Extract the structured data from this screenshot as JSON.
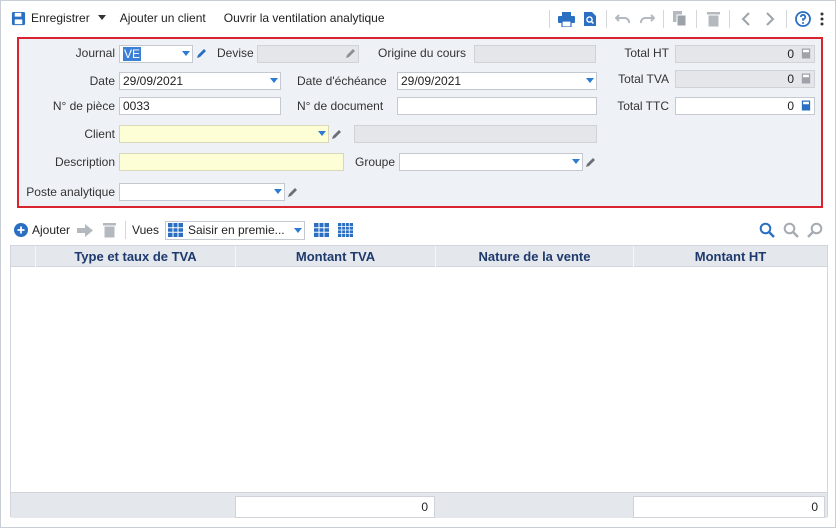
{
  "toolbar": {
    "save_label": "Enregistrer",
    "add_client_label": "Ajouter un client",
    "open_ventilation_label": "Ouvrir la ventilation analytique"
  },
  "form": {
    "journal": {
      "label": "Journal",
      "value": "VE"
    },
    "devise": {
      "label": "Devise",
      "value": ""
    },
    "origine_cours": {
      "label": "Origine du cours",
      "value": ""
    },
    "total_ht": {
      "label": "Total HT",
      "value": "0"
    },
    "date": {
      "label": "Date",
      "value": "29/09/2021"
    },
    "date_echeance": {
      "label": "Date d'échéance",
      "value": "29/09/2021"
    },
    "total_tva": {
      "label": "Total TVA",
      "value": "0"
    },
    "num_piece": {
      "label": "N° de pièce",
      "value": "0033"
    },
    "num_document": {
      "label": "N° de document",
      "value": ""
    },
    "total_ttc": {
      "label": "Total TTC",
      "value": "0"
    },
    "client": {
      "label": "Client",
      "value": "",
      "name_value": ""
    },
    "description": {
      "label": "Description",
      "value": ""
    },
    "groupe": {
      "label": "Groupe",
      "value": ""
    },
    "poste_analytique": {
      "label": "Poste analytique",
      "value": ""
    }
  },
  "grid_toolbar": {
    "add_label": "Ajouter",
    "vues_label": "Vues",
    "vues_value": "Saisir en premie..."
  },
  "grid": {
    "columns": [
      "Type et taux de TVA",
      "Montant TVA",
      "Nature de la vente",
      "Montant HT"
    ],
    "rows": [],
    "footer": {
      "montant_tva_total": "0",
      "montant_ht_total": "0"
    }
  },
  "colors": {
    "accent": "#2d7bd3",
    "highlight_border": "#d9232e",
    "header_text": "#1e3a6d"
  }
}
